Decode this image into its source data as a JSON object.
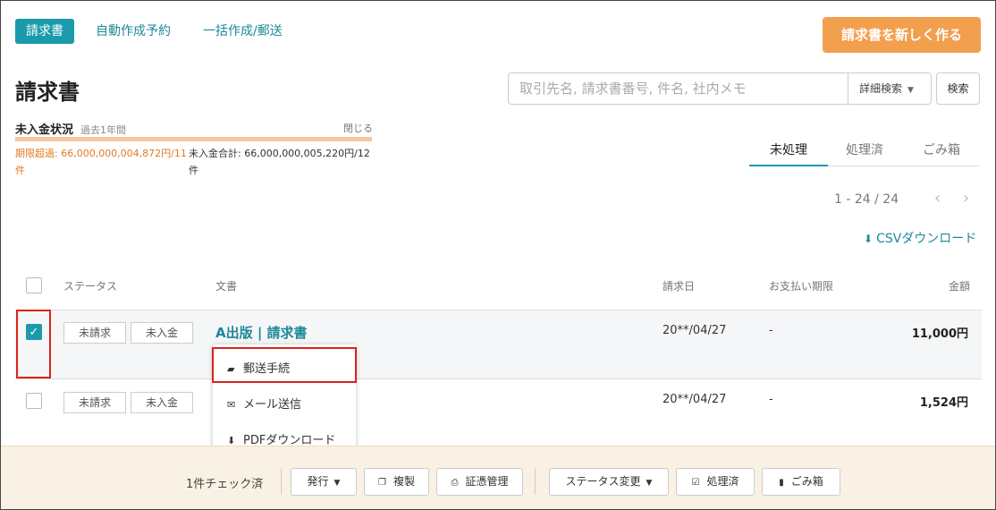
{
  "nav": {
    "tabs": [
      "請求書",
      "自動作成予約",
      "一括作成/郵送"
    ],
    "create_button": "請求書を新しく作る"
  },
  "page_title": "請求書",
  "search": {
    "placeholder": "取引先名, 請求書番号, 件名, 社内メモ",
    "advanced_label": "詳細検索",
    "button_label": "検索"
  },
  "unpaid_status": {
    "title": "未入金状況",
    "period": "過去1年間",
    "close_label": "閉じる",
    "overdue_text": "期限超過: 66,000,000,004,872円/11件",
    "total_text": "未入金合計: 66,000,000,005,220円/12件"
  },
  "tabs": [
    "未処理",
    "処理済",
    "ごみ箱"
  ],
  "pagination": {
    "range": "1 - 24 / 24"
  },
  "csv_download": "CSVダウンロード",
  "table": {
    "headers": [
      "ステータス",
      "文書",
      "請求日",
      "お支払い期限",
      "金額"
    ],
    "rows": [
      {
        "status1": "未請求",
        "status2": "未入金",
        "document": "A出版 | 請求書",
        "date": "20**/04/27",
        "due": "-",
        "amount": "11,000円",
        "checked": true
      },
      {
        "status1": "未請求",
        "status2": "未入金",
        "document": "",
        "date": "20**/04/27",
        "due": "-",
        "amount": "1,524円",
        "checked": false
      }
    ]
  },
  "dropdown": {
    "items": [
      "郵送手続",
      "メール送信",
      "PDFダウンロード"
    ]
  },
  "action_bar": {
    "checked_count": "1件チェック済",
    "issue": "発行",
    "duplicate": "複製",
    "evidence": "証憑管理",
    "status_change": "ステータス変更",
    "processed": "処理済",
    "trash": "ごみ箱"
  },
  "colors": {
    "accent": "#1a9aaa",
    "create_button": "#f29f4e",
    "overdue": "#e07a22",
    "highlight": "#d9231b"
  }
}
